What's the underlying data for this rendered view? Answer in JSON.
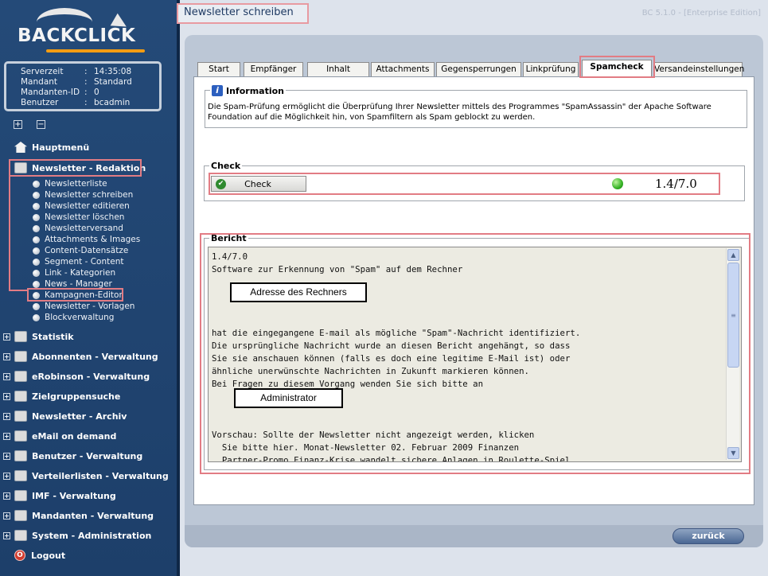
{
  "brand": {
    "logo_text": "BACKCLICK"
  },
  "server_info": [
    {
      "key": "Serverzeit",
      "sep": ":",
      "value": "14:35:08"
    },
    {
      "key": "Mandant",
      "sep": ":",
      "value": "Standard"
    },
    {
      "key": "Mandanten-ID",
      "sep": ":",
      "value": "0"
    },
    {
      "key": "Benutzer",
      "sep": ":",
      "value": "bcadmin"
    }
  ],
  "tree_controls": {
    "expand": "+",
    "collapse": "−"
  },
  "nav": {
    "home": "Hauptmenü",
    "redaktion": "Newsletter - Redaktion",
    "sub_items": [
      "Newsletterliste",
      "Newsletter schreiben",
      "Newsletter editieren",
      "Newsletter löschen",
      "Newsletterversand",
      "Attachments & Images",
      "Content-Datensätze",
      "Segment - Content",
      "Link - Kategorien",
      "News - Manager",
      "Kampagnen-Editor",
      "Newsletter - Vorlagen",
      "Blockverwaltung"
    ],
    "sections": [
      "Statistik",
      "Abonnenten - Verwaltung",
      "eRobinson - Verwaltung",
      "Zielgruppensuche",
      "Newsletter - Archiv",
      "eMail on demand",
      "Benutzer - Verwaltung",
      "Verteilerlisten - Verwaltung",
      "IMF - Verwaltung",
      "Mandanten - Verwaltung",
      "System - Administration"
    ],
    "logout": "Logout"
  },
  "header": {
    "title": "Newsletter schreiben",
    "version": "BC 5.1.0 - [Enterprise Edition]"
  },
  "tabs": [
    "Start",
    "Empfänger",
    "Inhalt",
    "Attachments",
    "Gegensperrungen",
    "Linkprüfung",
    "Spamcheck",
    "Versandeinstellungen"
  ],
  "active_tab": "Spamcheck",
  "information": {
    "legend": "Information",
    "text": "Die Spam-Prüfung ermöglicht die Überprüfung Ihrer Newsletter mittels des Programmes \"SpamAssassin\" der Apache Software Foundation auf die Möglichkeit hin, von Spamfiltern als Spam geblockt zu werden."
  },
  "check": {
    "legend": "Check",
    "button_label": "Check",
    "score": "1.4/7.0"
  },
  "report": {
    "legend": "Bericht",
    "text": "1.4/7.0\nSoftware zur Erkennung von \"Spam\" auf dem Rechner\n\n\n\n\nhat die eingegangene E-mail als mögliche \"Spam\"-Nachricht identifiziert.\nDie ursprüngliche Nachricht wurde an diesen Bericht angehängt, so dass\nSie sie anschauen können (falls es doch eine legitime E-Mail ist) oder\nähnliche unerwünschte Nachrichten in Zukunft markieren können.\nBei Fragen zu diesem Vorgang wenden Sie sich bitte an\n\n\n\nVorschau: Sollte der Newsletter nicht angezeigt werden, klicken\n  Sie bitte hier. Monat-Newsletter 02. Februar 2009 Finanzen\n  Partner-Promo Finanz-Krise wandelt sichere Anlagen in Roulette-Spiel\n  Zertifikate, Tagesgeld, Fonds, etc. - auch Anlagen, die als sicher",
    "redacted_1": "Adresse des Rechners",
    "redacted_2": "Administrator"
  },
  "footer": {
    "back_label": "zurück"
  },
  "colors": {
    "sidebar": "#1d3f6a",
    "highlight": "#e27c84",
    "status_ok": "#35b224"
  }
}
